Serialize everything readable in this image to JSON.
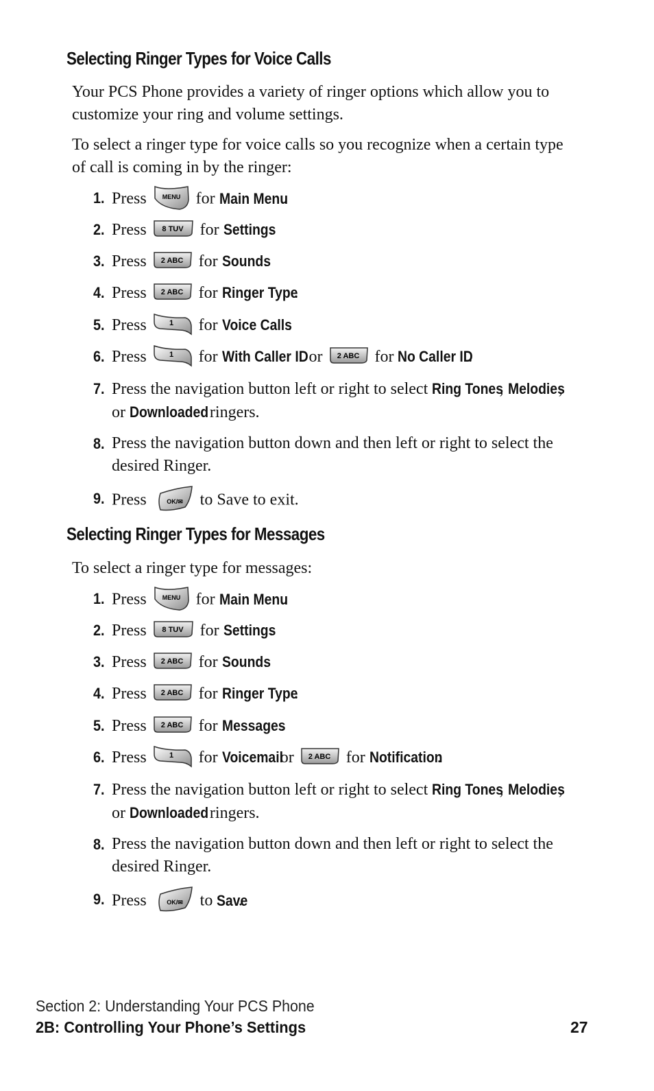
{
  "section1": {
    "heading": "Selecting Ringer Types for Voice Calls",
    "intro1": "Your PCS Phone provides a variety of ringer options which allow you to customize your ring and volume settings.",
    "intro2": "To select a ringer type for voice calls so you recognize when a certain type of call is coming in by the ringer:",
    "steps": [
      {
        "num": "1.",
        "pre": "Press",
        "key": "MENU",
        "mid": "for",
        "target": "Main Menu",
        "end": "."
      },
      {
        "num": "2.",
        "pre": "Press",
        "key": "8 TUV",
        "mid": "for",
        "target": "Settings",
        "end": "."
      },
      {
        "num": "3.",
        "pre": "Press",
        "key": "2 ABC",
        "mid": "for",
        "target": "Sounds",
        "end": "."
      },
      {
        "num": "4.",
        "pre": "Press",
        "key": "2 ABC",
        "mid": "for",
        "target": "Ringer Type",
        "end": "."
      },
      {
        "num": "5.",
        "pre": "Press",
        "key": "1",
        "mid": "for",
        "target": "Voice Calls",
        "end": "."
      },
      {
        "num": "6.",
        "pre": "Press",
        "key": "1",
        "mid": "for",
        "target": "With Caller ID",
        "or": "or",
        "key2": "2 ABC",
        "mid2": "for",
        "target2": "No Caller ID",
        "end": "."
      },
      {
        "num": "7.",
        "text_a": "Press the navigation button left or right to select",
        "opt1": "Ring Tones",
        "sep1": ",",
        "opt2": "Melodies",
        "sep2": ", or",
        "opt3": "Downloaded",
        "text_b": "ringers."
      },
      {
        "num": "8.",
        "text": "Press the navigation button down and then left or right to select the desired Ringer."
      },
      {
        "num": "9.",
        "pre": "Press",
        "key": "OK/✉",
        "post": "to Save to exit."
      }
    ]
  },
  "section2": {
    "heading": "Selecting Ringer Types for Messages",
    "intro": "To select a ringer type for messages:",
    "steps": [
      {
        "num": "1.",
        "pre": "Press",
        "key": "MENU",
        "mid": "for",
        "target": "Main Menu",
        "end": "."
      },
      {
        "num": "2.",
        "pre": "Press",
        "key": "8 TUV",
        "mid": "for",
        "target": "Settings",
        "end": "."
      },
      {
        "num": "3.",
        "pre": "Press",
        "key": "2 ABC",
        "mid": "for",
        "target": "Sounds",
        "end": "."
      },
      {
        "num": "4.",
        "pre": "Press",
        "key": "2 ABC",
        "mid": "for",
        "target": "Ringer Type",
        "end": "."
      },
      {
        "num": "5.",
        "pre": "Press",
        "key": "2 ABC",
        "mid": "for",
        "target": "Messages",
        "end": "."
      },
      {
        "num": "6.",
        "pre": "Press",
        "key": "1",
        "mid": "for",
        "target": "Voicemail",
        "or": "or",
        "key2": "2 ABC",
        "mid2": "for",
        "target2": "Notification",
        "end": "."
      },
      {
        "num": "7.",
        "text_a": "Press the navigation button left or right to select",
        "opt1": "Ring Tones",
        "sep1": ",",
        "opt2": "Melodies",
        "sep2": ", or",
        "opt3": "Downloaded",
        "text_b": "ringers."
      },
      {
        "num": "8.",
        "text": "Press the navigation button down and then left or right to select the desired Ringer."
      },
      {
        "num": "9.",
        "pre": "Press",
        "key": "OK/✉",
        "mid": "to",
        "target": "Save",
        "end": "."
      }
    ]
  },
  "footer": {
    "section": "Section 2: Understanding Your PCS Phone",
    "chapter": "2B: Controlling Your Phone’s Settings",
    "page_number": "27"
  },
  "icons": {
    "menu_key": "menu-key-icon",
    "key_8": "key-8-tuv-icon",
    "key_2": "key-2-abc-icon",
    "key_1": "key-1-icon",
    "ok_key": "ok-message-key-icon"
  }
}
